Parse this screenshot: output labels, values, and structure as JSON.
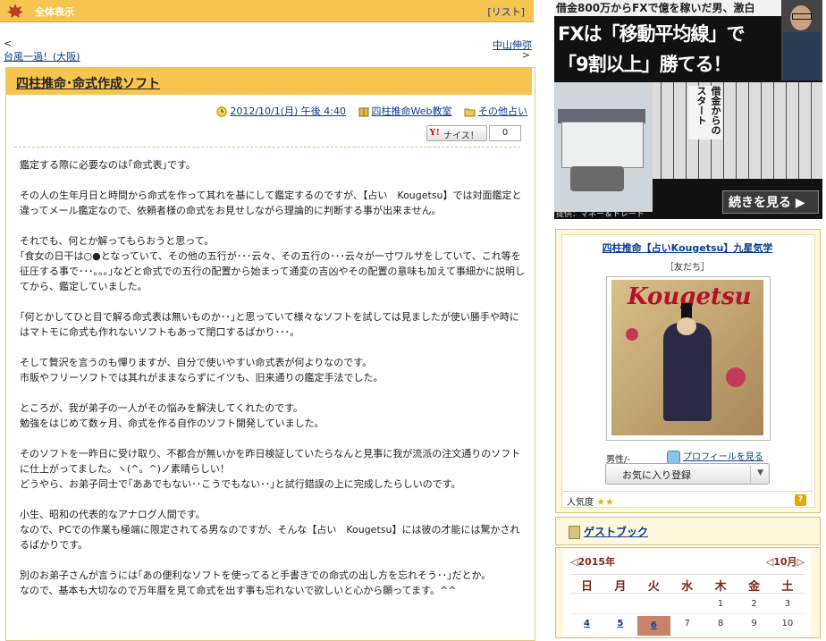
{
  "topbar": {
    "title": "全体表示",
    "list_label": "[リスト]"
  },
  "nav": {
    "prev_arrow": "<",
    "prev_title": "台風一過！(大阪)",
    "next_title": "中山伸弥",
    "next_arrow": ">"
  },
  "entry": {
    "title": "四柱推命･命式作成ソフト",
    "date": "2012/10/1(月) 午後 4:40",
    "category1": "四柱推命Web教室",
    "category2": "その他占い",
    "nice_label": "ナイス！",
    "nice_count": "0",
    "paragraphs": [
      "鑑定する際に必要なのは｢命式表｣です。",
      "その人の生年月日と時間から命式を作って其れを基にして鑑定するのですが、【占い　Kougetsu】では対面鑑定と違ってメール鑑定なので、依頼者様の命式をお見せしながら理論的に判断する事が出来ません。",
      "それでも、何とか解ってもらおうと思って。\n｢食女の日干は○●となっていて、その他の五行が･･･云々、その五行の･･･云々が一寸ワルサをしていて、これ等を征圧する事で･･･。。。｣などと命式での五行の配置から始まって通変の吉凶やその配置の意味も加えて事細かに説明してから、鑑定していました。",
      "｢何とかしてひと目で解る命式表は無いものか･･｣と思っていて様々なソフトを試しては見ましたが使い勝手や時にはマトモに命式も作れないソフトもあって閉口するばかり･･･。",
      "そして贅沢を言うのも憚りますが、自分で使いやすい命式表が何よりなのです。\n市販やフリーソフトでは其れがままならずにイツも、旧来通りの鑑定手法でした。",
      "",
      "ところが、我が弟子の一人がその悩みを解決してくれたのです。\n勉強をはじめて数ヶ月、命式を作る自作のソフト開発していました。",
      "そのソフトを一昨日に受け取り、不都合が無いかを昨日検証していたらなんと見事に我が流派の注文通りのソフトに仕上がってました。ヽ(^。^)ノ素晴らしい！\nどうやら、お弟子同士で｢ああでもない･･こうでもない･･｣と試行錯誤の上に完成したらしいのです。",
      "",
      "小生、昭和の代表的なアナログ人間です。\nなので、PCでの作業も極端に限定されてる男なのですが、そんな【占い　Kougetsu】には彼の才能には驚かされるばかりです。",
      "別のお弟子さんが言うには｢あの便利なソフトを使ってると手書きでの命式の出し方を忘れそう･･｣だとか。\nなので、基本も大切なので万年暦を見て命式を出す事も忘れないで欲しいと心から願ってます。^^"
    ]
  },
  "ad": {
    "top_text": "借金800万からFXで億を稼いだ男、激白",
    "line1": "FXは「移動平均線」で",
    "line2": "「9割以上」勝てる！",
    "side_title": "借金からのスタート",
    "cta": "続きを見る ▶",
    "credit": "提供：マネー＆トレード"
  },
  "profile": {
    "name": "四柱推命【占いKougetsu】九星気学",
    "tag": "［友だち］",
    "image_text": "Kougetsu",
    "gender": "男性/-",
    "profile_link": "プロフィールを見る",
    "favorite_label": "お気に入り登録",
    "popularity_label": "人気度",
    "stars": "★★"
  },
  "guestbook": {
    "label": "ゲストブック"
  },
  "calendar": {
    "prev": "◁2015年",
    "next": "◁10月▷",
    "weekdays": [
      "日",
      "月",
      "火",
      "水",
      "木",
      "金",
      "土"
    ],
    "row1": [
      "",
      "",
      "",
      "",
      "1",
      "2",
      "3"
    ],
    "row2": [
      "4",
      "5",
      "6",
      "7",
      "8",
      "9",
      "10"
    ],
    "today_index": 2,
    "link_indices": [
      0,
      1,
      2
    ]
  },
  "colors": {
    "header": "#f6c54f",
    "link": "#0b3d91",
    "calendar_text": "#7a2a1a"
  }
}
